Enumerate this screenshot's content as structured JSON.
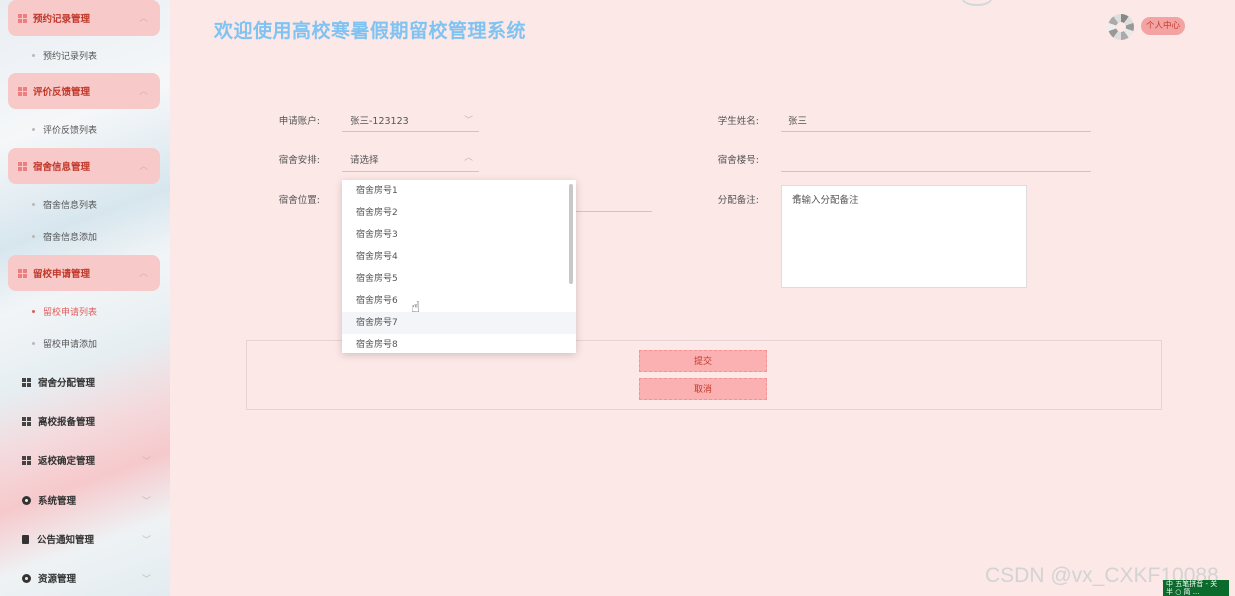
{
  "sidebar": {
    "groups": [
      {
        "label": "预约记录管理",
        "items": [
          "预约记录列表"
        ]
      },
      {
        "label": "评价反馈管理",
        "items": [
          "评价反馈列表"
        ]
      },
      {
        "label": "宿舍信息管理",
        "items": [
          "宿舍信息列表",
          "宿舍信息添加"
        ]
      },
      {
        "label": "留校申请管理",
        "items": [
          "留校申请列表",
          "留校申请添加"
        ]
      }
    ],
    "active_item": "留校申请列表",
    "plain": [
      "宿舍分配管理",
      "离校报备管理",
      "返校确定管理",
      "系统管理",
      "公告通知管理",
      "资源管理"
    ]
  },
  "header": {
    "title": "欢迎使用高校寒暑假期留校管理系统",
    "user_center": "个人中心"
  },
  "form": {
    "account_label": "申请账户:",
    "account_value": "张三-123123",
    "dorm_label": "宿舍安排:",
    "dorm_value": "请选择",
    "location_label": "宿舍位置:",
    "student_label": "学生姓名:",
    "student_value": "张三",
    "building_label": "宿舍楼号:",
    "remark_label": "分配备注:",
    "remark_placeholder": "请输入分配备注"
  },
  "dropdown": {
    "options": [
      "宿舍房号1",
      "宿舍房号2",
      "宿舍房号3",
      "宿舍房号4",
      "宿舍房号5",
      "宿舍房号6",
      "宿舍房号7",
      "宿舍房号8"
    ],
    "hovered": "宿舍房号7"
  },
  "actions": {
    "submit": "提交",
    "cancel": "取消"
  },
  "watermark": "CSDN @vx_CXKF10088",
  "tray": {
    "line1": "中 五笔拼音 - 关",
    "line2": "半 ○ 简 ..."
  },
  "colors": {
    "accent": "#f8c9c9",
    "title": "#7ec3f2",
    "button": "#fbb1b1",
    "active": "#e25c5c"
  }
}
